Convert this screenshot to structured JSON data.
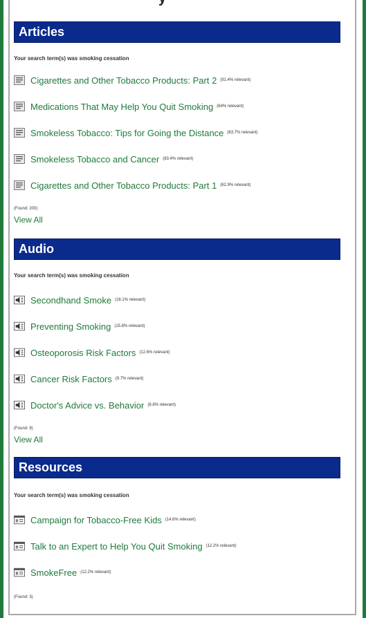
{
  "page_title_fragment": "y",
  "sections": {
    "articles": {
      "header": "Articles",
      "search_term_text": "Your search term(s) was smoking cessation",
      "items": [
        {
          "title": "Cigarettes and Other Tobacco Products: Part 2",
          "relevance": "(91.4% relevant)"
        },
        {
          "title": "Medications That May Help You Quit Smoking",
          "relevance": "(64% relevant)"
        },
        {
          "title": "Smokeless Tobacco: Tips for Going the Distance",
          "relevance": "(63.7% relevant)"
        },
        {
          "title": "Smokeless Tobacco and Cancer",
          "relevance": "(63.4% relevant)"
        },
        {
          "title": "Cigarettes and Other Tobacco Products: Part 1",
          "relevance": "(62.9% relevant)"
        }
      ],
      "found": "(Found: 200)",
      "view_all": "View All"
    },
    "audio": {
      "header": "Audio",
      "search_term_text": "Your search term(s) was smoking cessation",
      "items": [
        {
          "title": "Secondhand Smoke",
          "relevance": "(16.1% relevant)"
        },
        {
          "title": "Preventing Smoking",
          "relevance": "(15.8% relevant)"
        },
        {
          "title": "Osteoporosis Risk Factors",
          "relevance": "(12.6% relevant)"
        },
        {
          "title": "Cancer Risk Factors",
          "relevance": "(9.7% relevant)"
        },
        {
          "title": "Doctor's Advice vs. Behavior",
          "relevance": "(8.8% relevant)"
        }
      ],
      "found": "(Found: 8)",
      "view_all": "View All"
    },
    "resources": {
      "header": "Resources",
      "search_term_text": "Your search term(s) was smoking cessation",
      "items": [
        {
          "title": "Campaign for Tobacco-Free Kids",
          "relevance": "(14.6% relevant)"
        },
        {
          "title": "Talk to an Expert to Help You Quit Smoking",
          "relevance": "(12.2% relevant)"
        },
        {
          "title": "SmokeFree",
          "relevance": "(12.2% relevant)"
        }
      ],
      "found": "(Found: 3)"
    }
  },
  "icons": {
    "articles": "document-icon",
    "audio": "speaker-icon",
    "resources": "web-page-icon"
  },
  "colors": {
    "header_bg": "#0a2a8c",
    "link": "#1f7a3a",
    "border_accent": "#1f7a3a"
  }
}
